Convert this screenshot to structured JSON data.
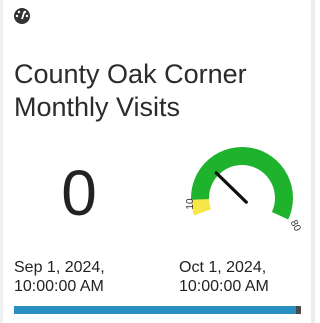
{
  "widget": {
    "icon": "dashboard-gauge-icon",
    "title_line1": "County Oak Corner",
    "title_line2": "Monthly Visits",
    "count": "0",
    "gauge": {
      "value": 30,
      "min_label": "10",
      "max_label": "80",
      "colors": {
        "low": "#f7e84a",
        "high": "#1fb32d",
        "track_bg": "#e8e8e8",
        "needle": "#111111"
      }
    },
    "start_date_line1": "Sep 1, 2024,",
    "start_date_line2": "10:00:00 AM",
    "end_date_line1": "Oct 1, 2024,",
    "end_date_line2": "10:00:00 AM",
    "timebar_color": "#2a8fc1"
  }
}
